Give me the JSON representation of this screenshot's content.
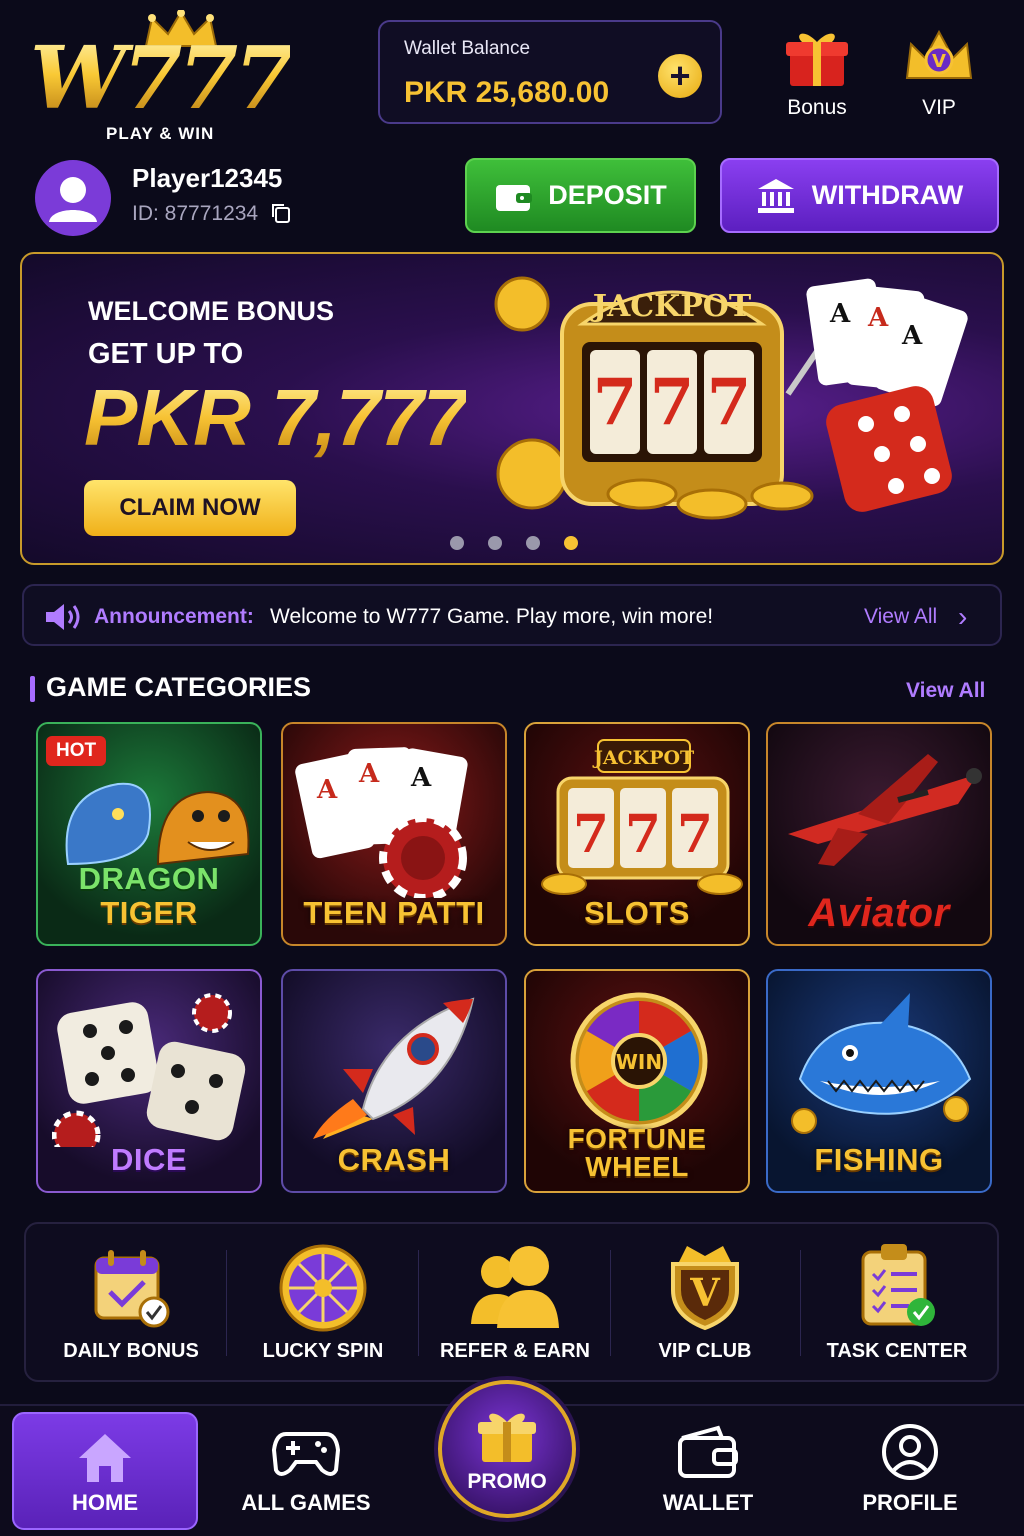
{
  "app": {
    "logo_text": "W777",
    "logo_tagline": "PLAY & WIN"
  },
  "wallet": {
    "label": "Wallet Balance",
    "amount": "PKR 25,680.00",
    "add_symbol": "+"
  },
  "header_actions": [
    {
      "label": "Bonus",
      "icon": "gift-icon"
    },
    {
      "label": "VIP",
      "icon": "vip-crown-icon"
    }
  ],
  "user": {
    "name": "Player12345",
    "id_text": "ID: 87771234"
  },
  "actions": {
    "deposit": "DEPOSIT",
    "withdraw": "WITHDRAW"
  },
  "banner": {
    "line1": "WELCOME BONUS",
    "line2": "GET UP TO",
    "amount": "PKR 7,777",
    "cta": "CLAIM NOW",
    "jackpot_label": "JACKPOT",
    "slides": 4,
    "active_slide": 4
  },
  "announcement": {
    "label": "Announcement:",
    "message": "Welcome to W777 Game. Play more, win more!",
    "view_all": "View All"
  },
  "categories": {
    "title": "GAME CATEGORIES",
    "view_all": "View All",
    "hot_badge": "HOT",
    "items": [
      {
        "line1": "DRAGON",
        "line2": "TIGER"
      },
      {
        "line1": "TEEN PATTI",
        "line2": ""
      },
      {
        "line1": "SLOTS",
        "line2": "",
        "badge": "JACKPOT"
      },
      {
        "line1": "Aviator",
        "line2": ""
      },
      {
        "line1": "DICE",
        "line2": ""
      },
      {
        "line1": "CRASH",
        "line2": ""
      },
      {
        "line1": "FORTUNE",
        "line2": "WHEEL",
        "badge": "WIN"
      },
      {
        "line1": "FISHING",
        "line2": ""
      }
    ]
  },
  "features": [
    {
      "label": "DAILY BONUS",
      "icon": "calendar-check-icon"
    },
    {
      "label": "LUCKY SPIN",
      "icon": "spin-wheel-icon"
    },
    {
      "label": "REFER & EARN",
      "icon": "users-icon"
    },
    {
      "label": "VIP CLUB",
      "icon": "vip-shield-icon"
    },
    {
      "label": "TASK CENTER",
      "icon": "clipboard-check-icon"
    }
  ],
  "nav": {
    "home": "HOME",
    "all_games": "ALL GAMES",
    "promo": "PROMO",
    "wallet": "WALLET",
    "profile": "PROFILE"
  },
  "colors": {
    "background": "#0b0a1a",
    "gold": "#f7c233",
    "purple_accent": "#b07cff",
    "deposit_green": "#2fa52c",
    "withdraw_purple": "#6d2ad6"
  }
}
